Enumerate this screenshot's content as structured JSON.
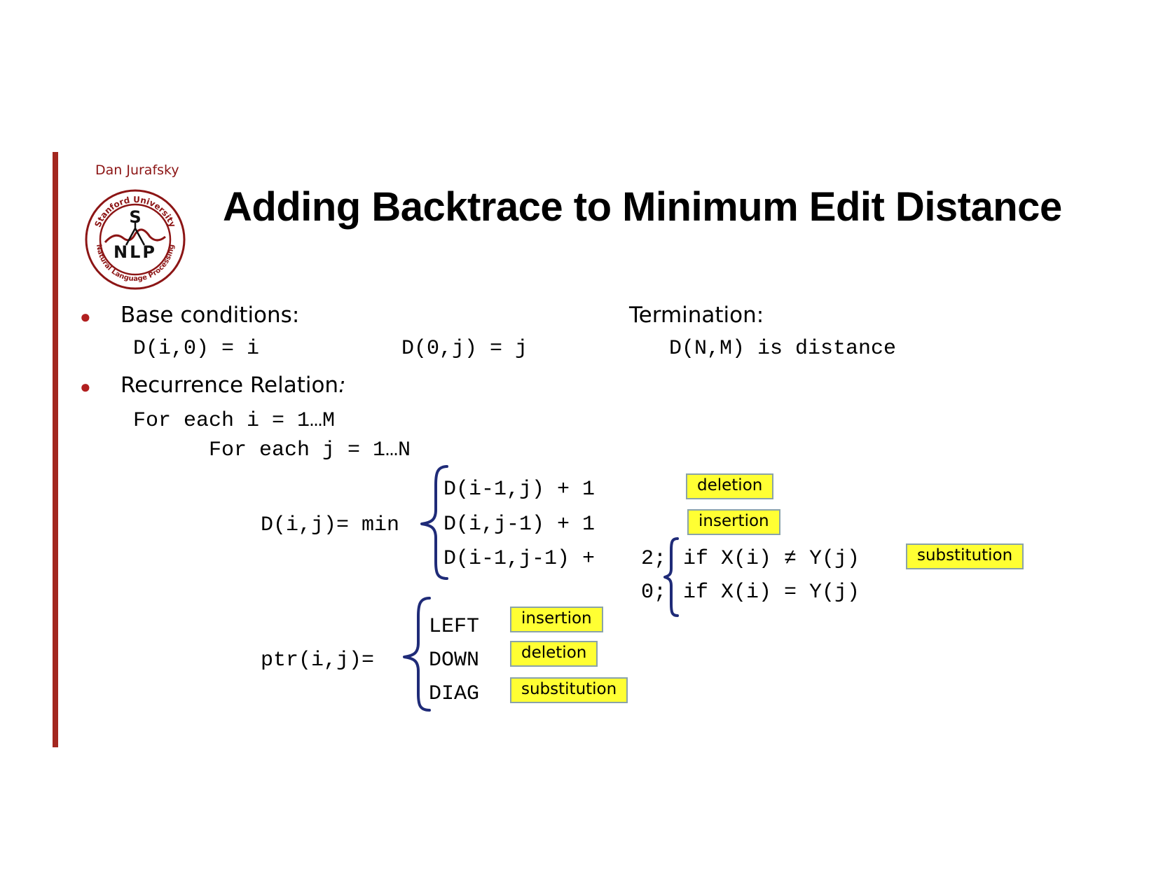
{
  "slide": {
    "author": "Dan Jurafsky",
    "title": "Adding Backtrace to Minimum Edit Distance",
    "logo": {
      "top_text": "Stanford University",
      "letter_top": "S",
      "letters_bottom": "NLP",
      "bottom_text": "Natural Language Processing"
    }
  },
  "colors": {
    "accent": "#a3271f",
    "brace": "#1f2b78",
    "highlight": "#ffff33"
  },
  "base": {
    "heading": "Base conditions:",
    "cond1": "D(i,0) = i",
    "cond2": "D(0,j) = j"
  },
  "termination": {
    "heading": "Termination:",
    "text": "D(N,M) is distance"
  },
  "recurrence": {
    "heading": "Recurrence Relation",
    "colon": ":",
    "loop1": "For each  i = 1…M",
    "loop2": "For each  j = 1…N",
    "lhs": "D(i,j)= min",
    "case1": "D(i-1,j) + 1",
    "case2": "D(i,j-1) + 1",
    "case3": "D(i-1,j-1) +",
    "sub1_val": "2;",
    "sub1_cond": "if X(i) ≠ Y(j)",
    "sub2_val": "0;",
    "sub2_cond": "if X(i) = Y(j)",
    "tag1": "deletion",
    "tag2": "insertion",
    "tag3": "substitution"
  },
  "pointer": {
    "lhs": "ptr(i,j)=",
    "opt1": "LEFT",
    "opt2": "DOWN",
    "opt3": "DIAG",
    "tag1": "insertion",
    "tag2": "deletion",
    "tag3": "substitution"
  }
}
